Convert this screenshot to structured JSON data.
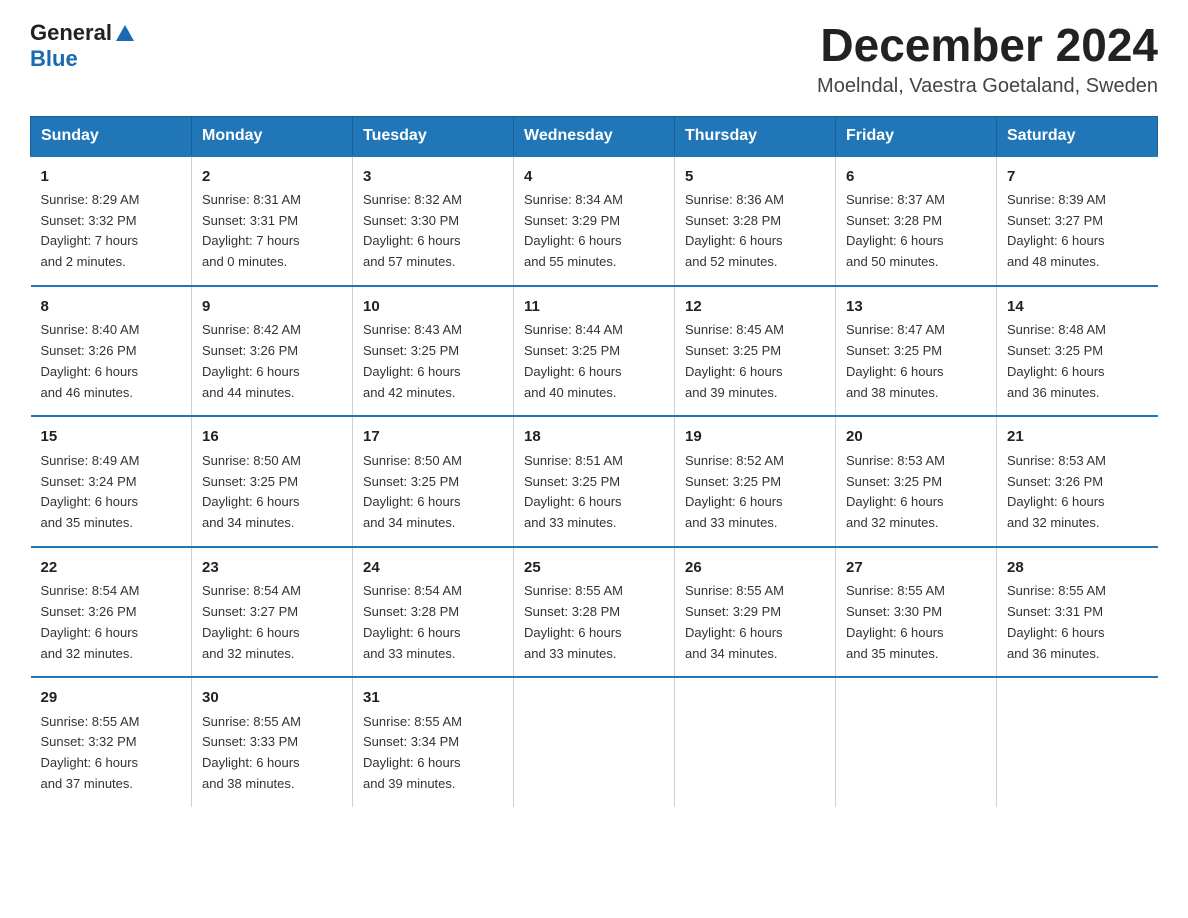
{
  "header": {
    "logo_general": "General",
    "logo_blue": "Blue",
    "month_year": "December 2024",
    "location": "Moelndal, Vaestra Goetaland, Sweden"
  },
  "days_of_week": [
    "Sunday",
    "Monday",
    "Tuesday",
    "Wednesday",
    "Thursday",
    "Friday",
    "Saturday"
  ],
  "weeks": [
    [
      {
        "num": "1",
        "sunrise": "8:29 AM",
        "sunset": "3:32 PM",
        "daylight": "7 hours and 2 minutes."
      },
      {
        "num": "2",
        "sunrise": "8:31 AM",
        "sunset": "3:31 PM",
        "daylight": "7 hours and 0 minutes."
      },
      {
        "num": "3",
        "sunrise": "8:32 AM",
        "sunset": "3:30 PM",
        "daylight": "6 hours and 57 minutes."
      },
      {
        "num": "4",
        "sunrise": "8:34 AM",
        "sunset": "3:29 PM",
        "daylight": "6 hours and 55 minutes."
      },
      {
        "num": "5",
        "sunrise": "8:36 AM",
        "sunset": "3:28 PM",
        "daylight": "6 hours and 52 minutes."
      },
      {
        "num": "6",
        "sunrise": "8:37 AM",
        "sunset": "3:28 PM",
        "daylight": "6 hours and 50 minutes."
      },
      {
        "num": "7",
        "sunrise": "8:39 AM",
        "sunset": "3:27 PM",
        "daylight": "6 hours and 48 minutes."
      }
    ],
    [
      {
        "num": "8",
        "sunrise": "8:40 AM",
        "sunset": "3:26 PM",
        "daylight": "6 hours and 46 minutes."
      },
      {
        "num": "9",
        "sunrise": "8:42 AM",
        "sunset": "3:26 PM",
        "daylight": "6 hours and 44 minutes."
      },
      {
        "num": "10",
        "sunrise": "8:43 AM",
        "sunset": "3:25 PM",
        "daylight": "6 hours and 42 minutes."
      },
      {
        "num": "11",
        "sunrise": "8:44 AM",
        "sunset": "3:25 PM",
        "daylight": "6 hours and 40 minutes."
      },
      {
        "num": "12",
        "sunrise": "8:45 AM",
        "sunset": "3:25 PM",
        "daylight": "6 hours and 39 minutes."
      },
      {
        "num": "13",
        "sunrise": "8:47 AM",
        "sunset": "3:25 PM",
        "daylight": "6 hours and 38 minutes."
      },
      {
        "num": "14",
        "sunrise": "8:48 AM",
        "sunset": "3:25 PM",
        "daylight": "6 hours and 36 minutes."
      }
    ],
    [
      {
        "num": "15",
        "sunrise": "8:49 AM",
        "sunset": "3:24 PM",
        "daylight": "6 hours and 35 minutes."
      },
      {
        "num": "16",
        "sunrise": "8:50 AM",
        "sunset": "3:25 PM",
        "daylight": "6 hours and 34 minutes."
      },
      {
        "num": "17",
        "sunrise": "8:50 AM",
        "sunset": "3:25 PM",
        "daylight": "6 hours and 34 minutes."
      },
      {
        "num": "18",
        "sunrise": "8:51 AM",
        "sunset": "3:25 PM",
        "daylight": "6 hours and 33 minutes."
      },
      {
        "num": "19",
        "sunrise": "8:52 AM",
        "sunset": "3:25 PM",
        "daylight": "6 hours and 33 minutes."
      },
      {
        "num": "20",
        "sunrise": "8:53 AM",
        "sunset": "3:25 PM",
        "daylight": "6 hours and 32 minutes."
      },
      {
        "num": "21",
        "sunrise": "8:53 AM",
        "sunset": "3:26 PM",
        "daylight": "6 hours and 32 minutes."
      }
    ],
    [
      {
        "num": "22",
        "sunrise": "8:54 AM",
        "sunset": "3:26 PM",
        "daylight": "6 hours and 32 minutes."
      },
      {
        "num": "23",
        "sunrise": "8:54 AM",
        "sunset": "3:27 PM",
        "daylight": "6 hours and 32 minutes."
      },
      {
        "num": "24",
        "sunrise": "8:54 AM",
        "sunset": "3:28 PM",
        "daylight": "6 hours and 33 minutes."
      },
      {
        "num": "25",
        "sunrise": "8:55 AM",
        "sunset": "3:28 PM",
        "daylight": "6 hours and 33 minutes."
      },
      {
        "num": "26",
        "sunrise": "8:55 AM",
        "sunset": "3:29 PM",
        "daylight": "6 hours and 34 minutes."
      },
      {
        "num": "27",
        "sunrise": "8:55 AM",
        "sunset": "3:30 PM",
        "daylight": "6 hours and 35 minutes."
      },
      {
        "num": "28",
        "sunrise": "8:55 AM",
        "sunset": "3:31 PM",
        "daylight": "6 hours and 36 minutes."
      }
    ],
    [
      {
        "num": "29",
        "sunrise": "8:55 AM",
        "sunset": "3:32 PM",
        "daylight": "6 hours and 37 minutes."
      },
      {
        "num": "30",
        "sunrise": "8:55 AM",
        "sunset": "3:33 PM",
        "daylight": "6 hours and 38 minutes."
      },
      {
        "num": "31",
        "sunrise": "8:55 AM",
        "sunset": "3:34 PM",
        "daylight": "6 hours and 39 minutes."
      },
      null,
      null,
      null,
      null
    ]
  ],
  "labels": {
    "sunrise": "Sunrise:",
    "sunset": "Sunset:",
    "daylight": "Daylight:"
  }
}
